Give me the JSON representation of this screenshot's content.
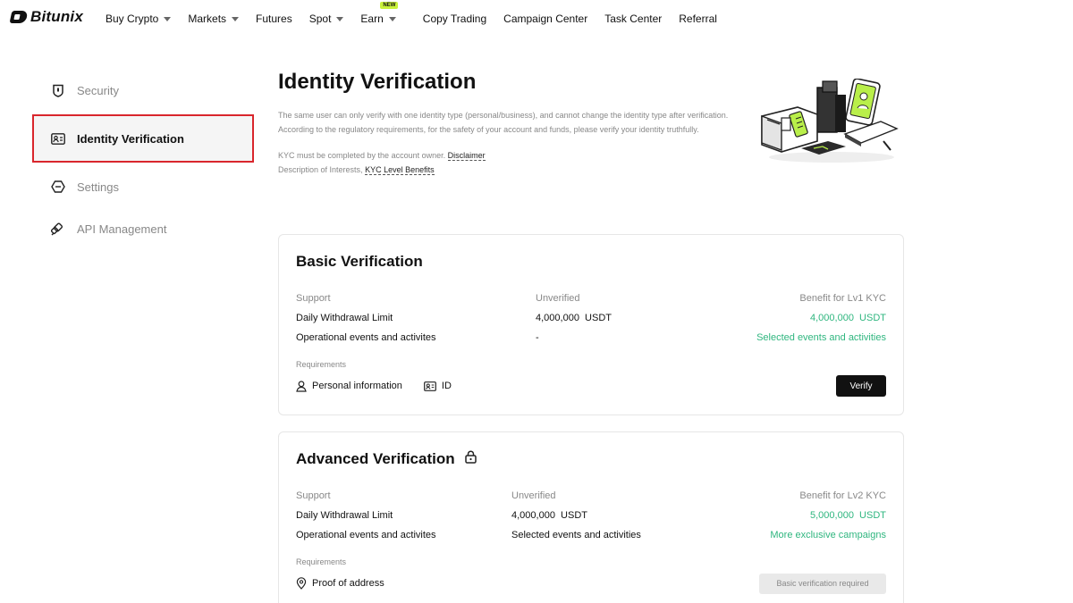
{
  "brand": {
    "name": "Bitunix"
  },
  "nav": {
    "items": [
      {
        "label": "Buy Crypto",
        "dropdown": true
      },
      {
        "label": "Markets",
        "dropdown": true
      },
      {
        "label": "Futures",
        "dropdown": false
      },
      {
        "label": "Spot",
        "dropdown": true
      },
      {
        "label": "Earn",
        "dropdown": true,
        "badge": "NEW"
      },
      {
        "label": "Copy Trading",
        "dropdown": false
      },
      {
        "label": "Campaign Center",
        "dropdown": false
      },
      {
        "label": "Task Center",
        "dropdown": false
      },
      {
        "label": "Referral",
        "dropdown": false
      }
    ]
  },
  "sidebar": {
    "items": [
      {
        "label": "Security",
        "icon": "shield-icon"
      },
      {
        "label": "Identity Verification",
        "icon": "id-card-icon",
        "active": true
      },
      {
        "label": "Settings",
        "icon": "settings-icon"
      },
      {
        "label": "API Management",
        "icon": "api-icon"
      }
    ]
  },
  "page": {
    "title": "Identity Verification",
    "desc1": "The same user can only verify with one identity type (personal/business), and cannot change the identity type after verification.",
    "desc2": "According to the regulatory requirements, for the safety of your account and funds, please verify your identity truthfully.",
    "kyc_owner_text": "KYC must be completed by the account owner.",
    "disclaimer_link": "Disclaimer",
    "interests_text": "Description of Interests,",
    "benefits_link": "KYC Level Benefits"
  },
  "basic": {
    "title": "Basic Verification",
    "col_support": "Support",
    "col_status": "Unverified",
    "col_benefit": "Benefit for Lv1 KYC",
    "row1_label": "Daily Withdrawal Limit",
    "row1_current": "4,000,000  USDT",
    "row1_benefit": "4,000,000  USDT",
    "row2_label": "Operational events and activites",
    "row2_current": "-",
    "row2_benefit": "Selected events and activities",
    "requirements_label": "Requirements",
    "req1": "Personal information",
    "req2": "ID",
    "verify_button": "Verify"
  },
  "advanced": {
    "title": "Advanced Verification",
    "col_support": "Support",
    "col_status": "Unverified",
    "col_benefit": "Benefit for Lv2 KYC",
    "row1_label": "Daily Withdrawal Limit",
    "row1_current": "4,000,000  USDT",
    "row1_benefit": "5,000,000  USDT",
    "row2_label": "Operational events and activites",
    "row2_current": "Selected events and activities",
    "row2_benefit": "More exclusive campaigns",
    "requirements_label": "Requirements",
    "req1": "Proof of address",
    "button": "Basic verification required"
  },
  "colors": {
    "accent_green": "#2fb67f",
    "highlight_red": "#d9262c",
    "badge_lime": "#c9f23a"
  }
}
